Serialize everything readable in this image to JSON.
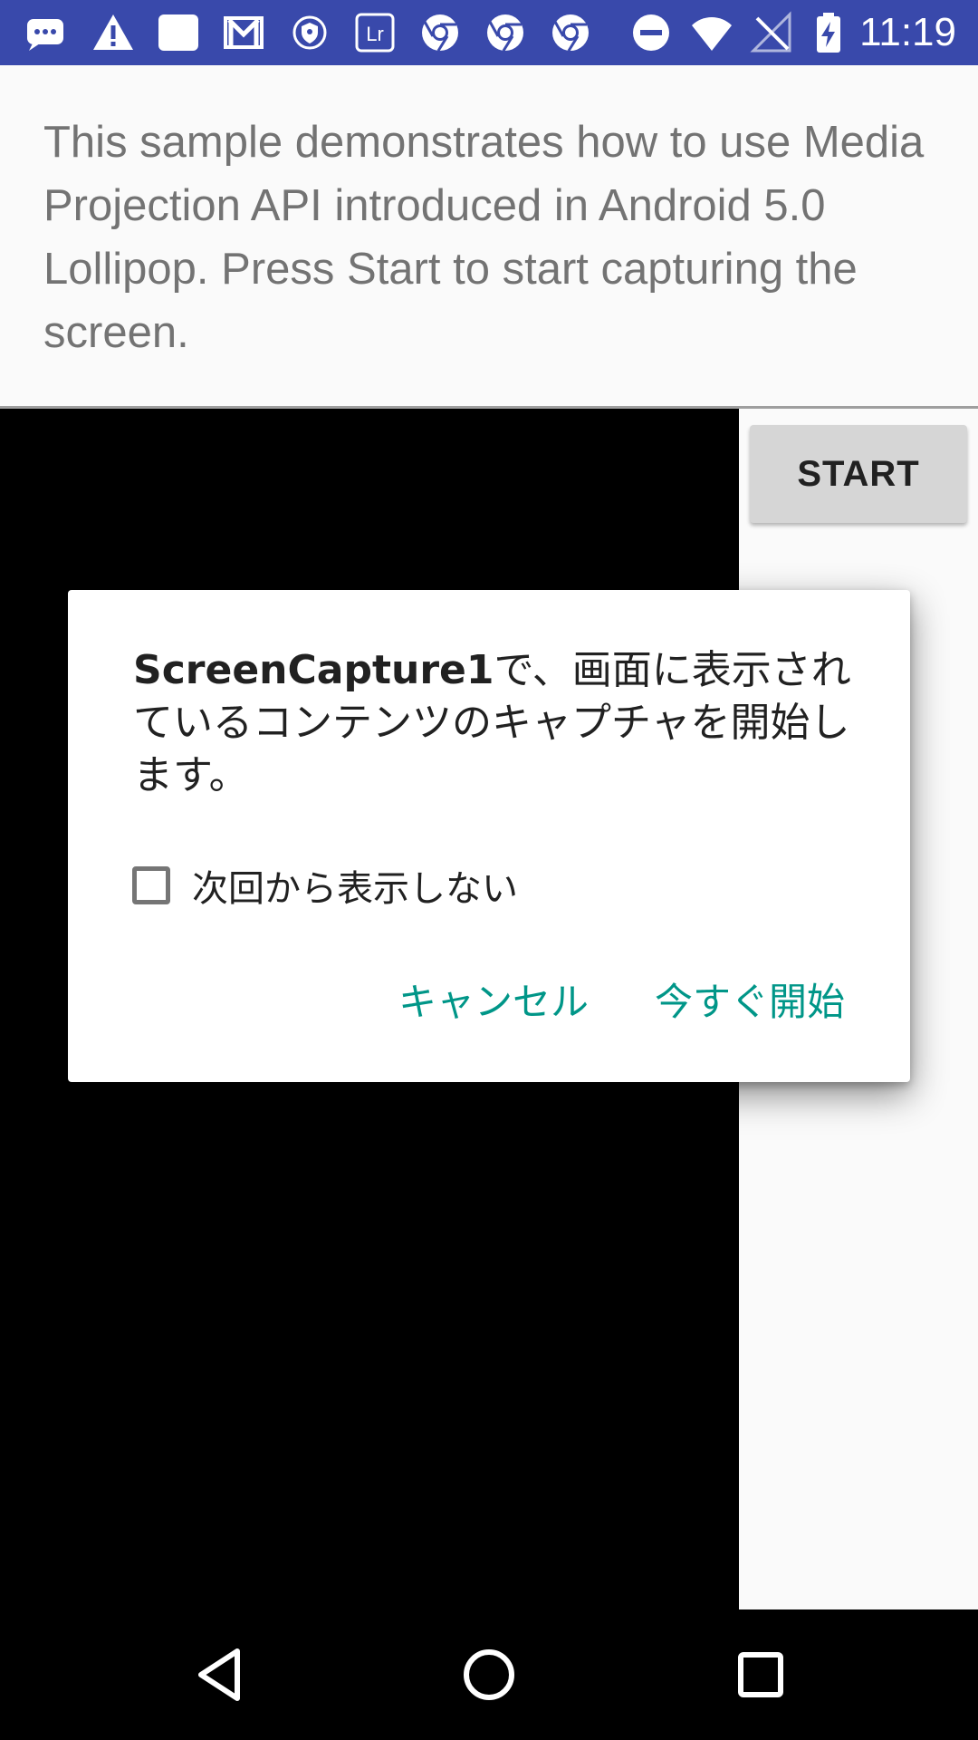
{
  "status_bar": {
    "time": "11:19",
    "icons": [
      "messages-icon",
      "warning-icon",
      "app-icon",
      "gmail-icon",
      "vpn-shield-icon",
      "lightroom-icon",
      "chrome-icon",
      "chrome-icon",
      "chrome-icon",
      "do-not-disturb-icon",
      "wifi-icon",
      "no-signal-icon",
      "battery-charging-icon"
    ],
    "lightroom_text": "Lr"
  },
  "main": {
    "description": "This sample demonstrates how to use Media Projection API introduced in Android 5.0 Lollipop. Press Start to start capturing the screen.",
    "start_button_label": "START"
  },
  "dialog": {
    "app_name": "ScreenCapture1",
    "message_rest": "で、画面に表示されているコンテンツのキャプチャを開始します。",
    "checkbox_label": "次回から表示しない",
    "checkbox_checked": false,
    "cancel_label": "キャンセル",
    "start_now_label": "今すぐ開始",
    "accent_color": "#009688"
  },
  "nav_bar": {
    "icons": [
      "back-icon",
      "home-icon",
      "recents-icon"
    ]
  }
}
